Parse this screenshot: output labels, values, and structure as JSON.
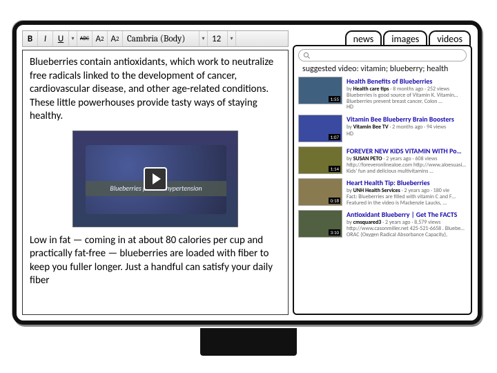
{
  "toolbar": {
    "bold": "B",
    "italic": "I",
    "underline": "U",
    "strike": "ABC",
    "superscript_main": "A",
    "superscript_mark": "2",
    "subscript_main": "A",
    "subscript_mark": "2",
    "font": "Cambria (Body)",
    "size": "12"
  },
  "doc": {
    "p1": "Blueberries contain antioxidants, which work to neutralize free radicals linked to the development of cancer, cardiovascular disease, and other age-related conditions. These little powerhouses provide tasty ways of staying healthy.",
    "video_caption": "Blueberries prevent hypertension",
    "p2": "Low in fat — coming in at about 80 calories per cup and practically fat-free — blueberries are loaded with fiber to keep you fuller longer. Just a handful can satisfy your daily fiber"
  },
  "panel": {
    "tabs": [
      "news",
      "images",
      "videos"
    ],
    "active_tab": 2,
    "search_placeholder": "",
    "suggested_prefix": "suggested video: ",
    "suggested_keywords": "vitamin; blueberry; health"
  },
  "results": [
    {
      "title": "Health Benefits of Blueberries",
      "author": "Health care tips",
      "age": "8 months ago",
      "views": "252 views",
      "desc": "Blueberries is good source of Vitamin K. Vitamin… Blueberries prevent breast cancer, Colon …",
      "hd": "HD",
      "dur": "1:55",
      "thumb_color": "#406080"
    },
    {
      "title": "Vitamin Bee Blueberry Brain Boosters",
      "author": "Vitamin Bee TV",
      "age": "2 months ago",
      "views": "94 views",
      "desc": "",
      "hd": "HD",
      "dur": "1:07",
      "thumb_color": "#3a4aa0"
    },
    {
      "title": "FOREVER NEW KIDS VITAMIN WITH Pomegranate,Cranberry,Mangosteen,Bl",
      "author": "SUSAN PETO",
      "age": "2 years ago",
      "views": "608 views",
      "desc": "http://foreveronlinealoe.com http://www.aloesuasi… Kids' fun and delicious multivitamins …",
      "hd": "",
      "dur": "1:14",
      "thumb_color": "#707030"
    },
    {
      "title": "Heart Health Tip: Blueberries",
      "author": "UNH Health Services",
      "age": "2 years ago",
      "views": "180 vie",
      "desc": "Fact: Blueberries are filled with vitamin C and F… Featured in the video is Mackenzie Laucks, …",
      "hd": "",
      "dur": "0:18",
      "thumb_color": "#8a7a50"
    },
    {
      "title": "Antioxidant Blueberry | Get The FACTS",
      "author": "cmsquared3",
      "age": "2 years ago",
      "views": "8,579 views",
      "desc": "http://www.casonmiller.net 425-521-6658 . Bluebe… ORAC (Oxygen Radical Absorbance Capacity),",
      "hd": "",
      "dur": "3:10",
      "thumb_color": "#506040"
    }
  ]
}
